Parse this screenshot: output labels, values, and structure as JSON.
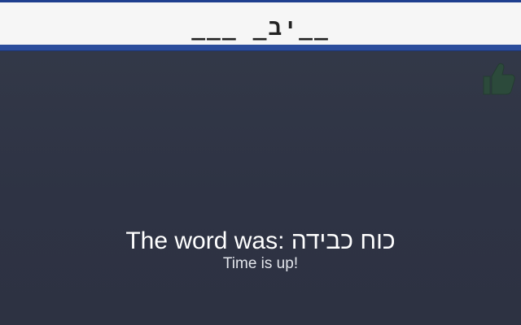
{
  "game": {
    "word_hint": "__יב_ ___",
    "result_label": "The word was:",
    "result_word": "כוח כבידה",
    "status": "Time is up!"
  },
  "icons": {
    "thumb": "thumbs-up-icon"
  },
  "colors": {
    "background": "#2f3444",
    "bar": "#f6f6f6",
    "border": "#2b4d9c",
    "thumb": "#2c4a3b"
  }
}
